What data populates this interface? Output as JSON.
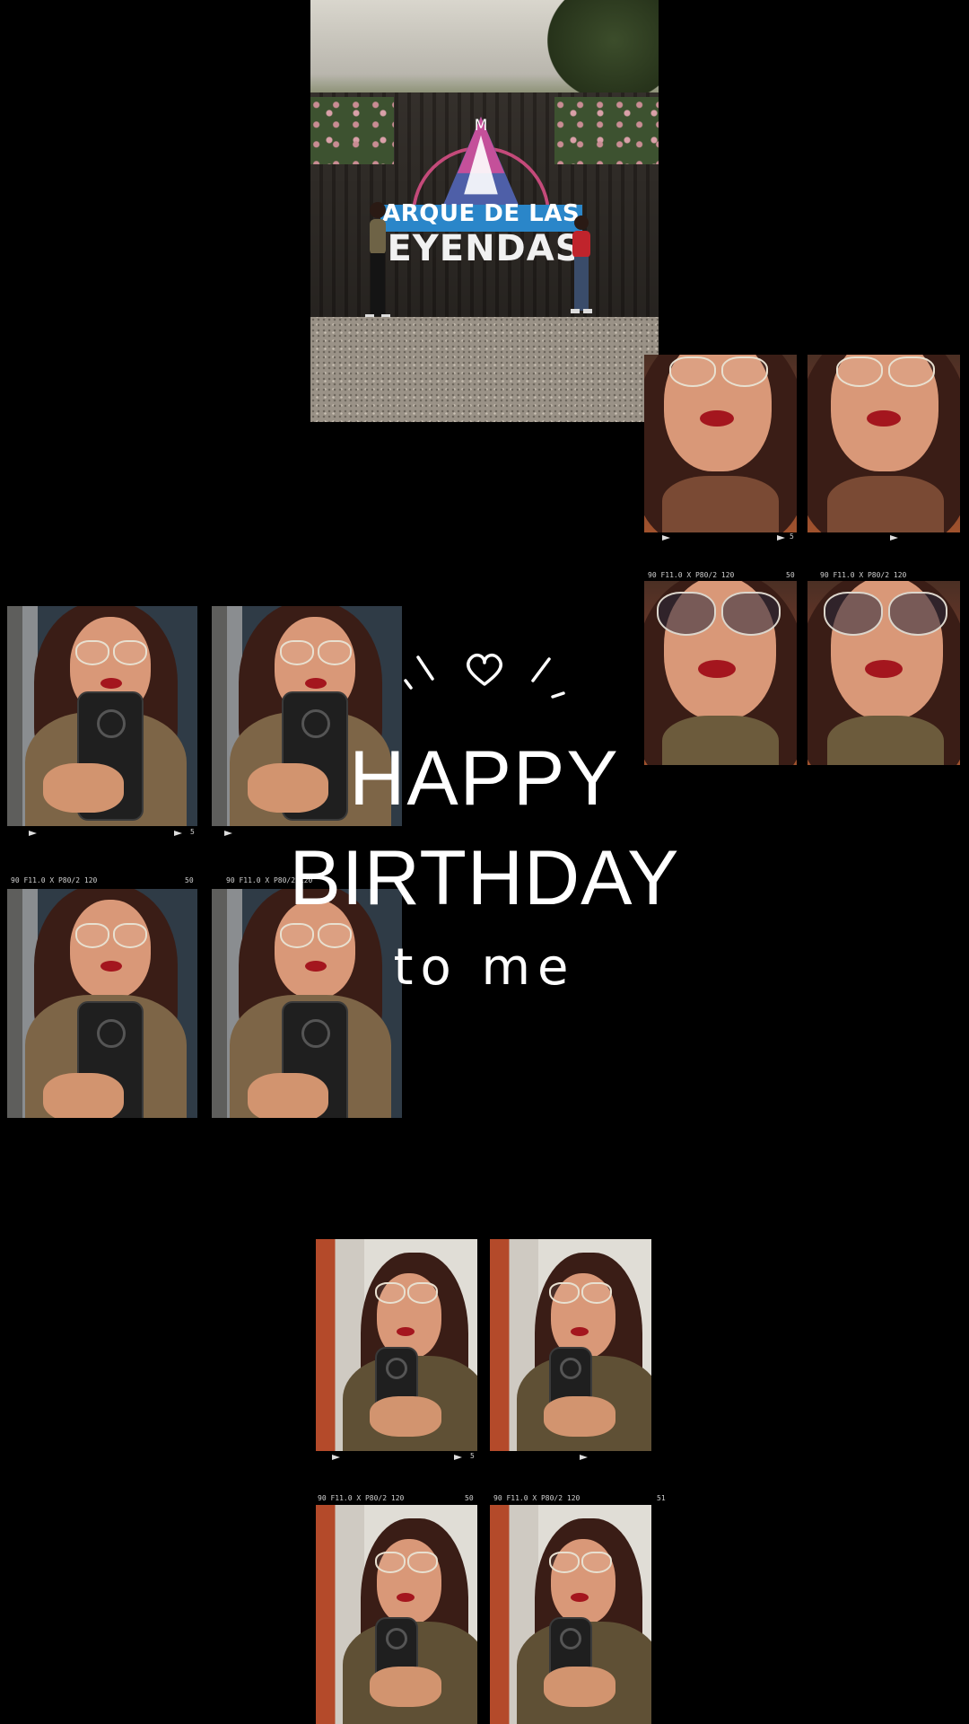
{
  "text": {
    "line1": "HAPPY",
    "line2": "BIRTHDAY",
    "line3": "to me"
  },
  "park_sign": {
    "line1": "ARQUE DE LAS",
    "line2": "EYENDAS"
  },
  "film": {
    "caption_a": "90 F11.0     X     P80/2 120",
    "frame_a": "50",
    "frame_b": "51",
    "frame_5": "5"
  },
  "colors": {
    "background": "#000000",
    "text": "#ffffff"
  }
}
